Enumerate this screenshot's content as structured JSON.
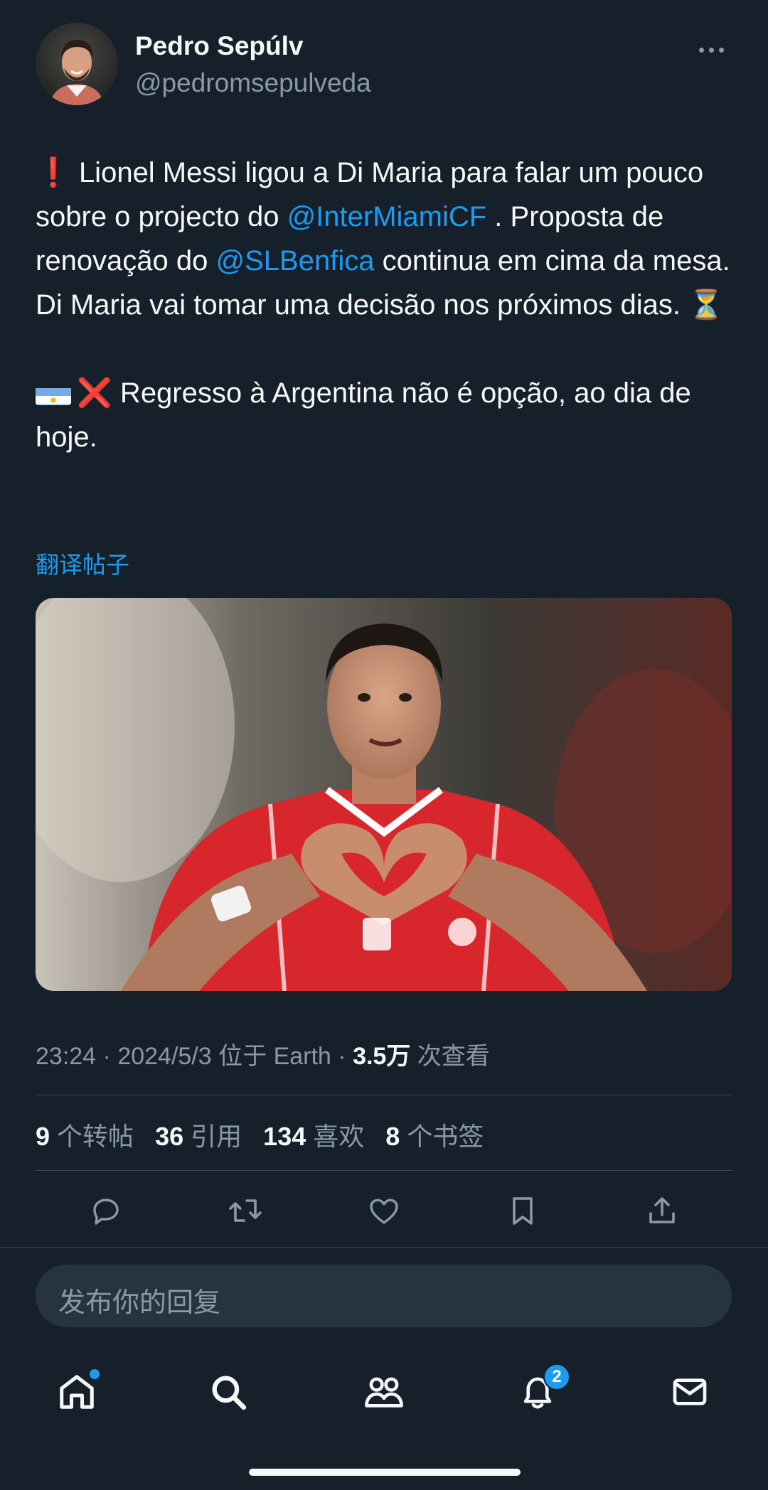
{
  "author": {
    "name": "Pedro Sepúlv",
    "handle": "@pedromsepulveda",
    "avatar_icon": "profile-photo"
  },
  "tweet": {
    "p1_part1": "Lionel Messi ligou a Di Maria para falar um pouco sobre o projecto do ",
    "mention_miami": "@InterMiamiCF",
    "p1_part2": " . Proposta de renovação do ",
    "mention_benfica": "@SLBenfica",
    "p1_part3": " continua em cima da mesa. Di Maria vai tomar uma decisão nos próximos dias. ",
    "p2_text": " Regresso à Argentina não é opção, ao dia de hoje.",
    "exclamation_emoji": "❗",
    "hourglass_emoji": "⏳",
    "cross_emoji": "❌"
  },
  "translate_label": "翻译帖子",
  "media": {
    "icon": "photo-di-maria-heart-gesture"
  },
  "meta": {
    "time": "23:24",
    "date": "2024/5/3",
    "location": "位于 Earth",
    "views_count": "3.5万",
    "views_label": "次查看"
  },
  "stats": {
    "reposts_count": "9",
    "reposts_label": "个转帖",
    "quotes_count": "36",
    "quotes_label": "引用",
    "likes_count": "134",
    "likes_label": "喜欢",
    "bookmarks_count": "8",
    "bookmarks_label": "个书签"
  },
  "reply": {
    "placeholder": "发布你的回复"
  },
  "nav": {
    "notifications_badge": "2"
  },
  "colors": {
    "background": "#15202b",
    "accent": "#1d9bf0",
    "muted": "#8b98a5",
    "text": "#f7f9f9"
  }
}
